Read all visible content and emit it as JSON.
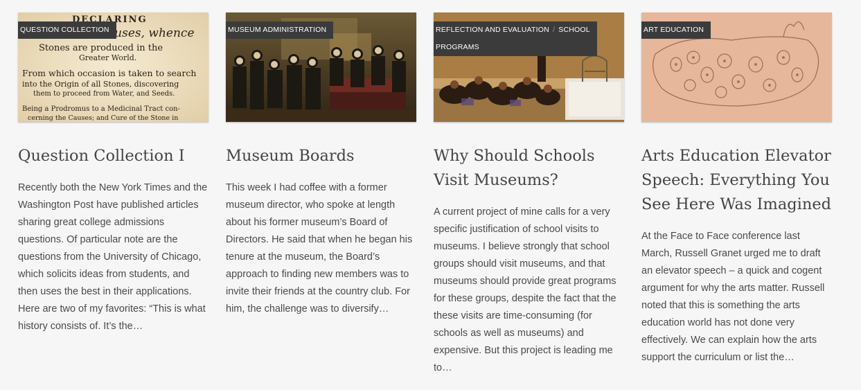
{
  "posts": [
    {
      "category": "QUESTION COLLECTION",
      "image_alt": "old printed page",
      "title": "Question Collection I",
      "excerpt": "Recently both the New York Times and the Washington Post have published articles sharing great college admissions questions.  Of particular note are the questions from the University of Chicago, which solicits ideas from students, and then uses the best in their applications.  Here are two of my favorites: “This is what history consists of. It’s the…",
      "image_text": [
        "DECLARING",
        "Causes, whence",
        "Stones are produced in the",
        "Greater World.",
        "From which occasion is taken to search",
        "into the Origin of all Stones, discovering",
        "them to proceed from Water, and Seeds.",
        "Being a Prodromus to a Medicinal Tract con-",
        "cerning the Causes; and Cure of the Stone in"
      ]
    },
    {
      "category": "MUSEUM ADMINISTRATION",
      "image_alt": "painting of a board meeting",
      "title": "Museum Boards",
      "excerpt": "This week I had coffee with a former museum director, who spoke at length about his former museum’s Board of Directors. He said that when he began his tenure at the museum, the Board’s approach to finding new members was to invite their friends at the country club.  For him, the challenge was to diversify…"
    },
    {
      "category": "REFLECTION AND EVALUATION",
      "category2": "SCHOOL PROGRAMS",
      "category2_a": "SCHOOL",
      "category2_b": "PROGRAMS",
      "image_alt": "students sitting on gallery floor",
      "title": "Why Should Schools Visit Museums?",
      "title_line1": "Why Should Schools",
      "title_line2": "Visit Museums?",
      "excerpt": "A current project of mine calls for a very specific justification of school visits to museums. I believe strongly that school groups should visit museums, and that museums should provide great programs for these groups, despite the fact that the these visits are time-consuming (for schools as well as museums) and expensive. But this project is leading me to…"
    },
    {
      "category": "ART EDUCATION",
      "image_alt": "child drawing of a creature",
      "title": "Arts Education Elevator Speech: Everything You See Here Was Imagined",
      "excerpt": "At the Face to Face conference last March, Russell Granet urged me to draft an elevator speech – a quick and cogent argument for why the arts matter.  Russell noted that this is something the arts education world has not done very effectively. We can explain how the arts support the curriculum or list the…"
    }
  ],
  "colors": {
    "tag_bg": "#3b3b3b",
    "tag_text": "#ffffff",
    "title": "#444444",
    "body_text": "#4a4a4a",
    "background": "#f6f6f6"
  }
}
